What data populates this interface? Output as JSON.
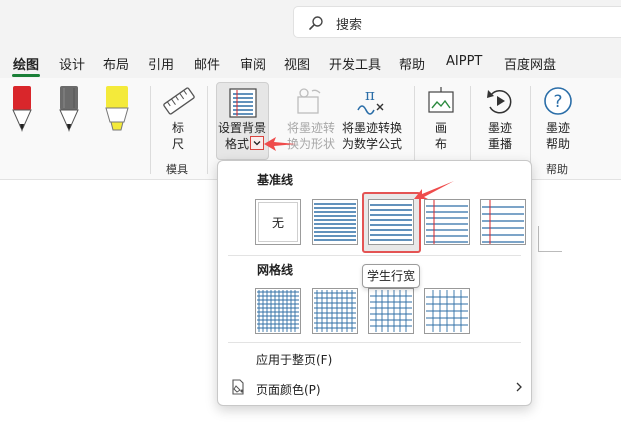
{
  "search": {
    "placeholder": "搜索"
  },
  "tabs": [
    {
      "label": "绘图",
      "active": true
    },
    {
      "label": "设计"
    },
    {
      "label": "布局"
    },
    {
      "label": "引用"
    },
    {
      "label": "邮件"
    },
    {
      "label": "审阅"
    },
    {
      "label": "视图"
    },
    {
      "label": "开发工具"
    },
    {
      "label": "帮助"
    },
    {
      "label": "AIPPT"
    },
    {
      "label": "百度网盘"
    }
  ],
  "ribbon": {
    "pens": [
      {
        "color": "#d9262b"
      },
      {
        "color": "#6b6b6b"
      },
      {
        "color": "#f4ea3a"
      }
    ],
    "ruler_label_1": "标",
    "ruler_label_2": "尺",
    "group_stencils": "模具",
    "bg_format_line1": "设置背景",
    "bg_format_line2": "格式",
    "ink_to_shape_line1": "将墨迹转",
    "ink_to_shape_line2": "换为形状",
    "ink_to_math_line1": "将墨迹转换",
    "ink_to_math_line2": "为数学公式",
    "canvas_line1": "画",
    "canvas_line2": "布",
    "replay_line1": "墨迹",
    "replay_line2": "重播",
    "help_line1": "墨迹",
    "help_line2": "帮助",
    "group_help": "帮助"
  },
  "popup": {
    "rule_lines_title": "基准线",
    "none_label": "无",
    "grid_lines_title": "网格线",
    "apply_to_all": "应用于整页(F)",
    "page_color": "页面颜色(P)",
    "tooltip": "学生行宽"
  },
  "colors": {
    "accent_green": "#1a7f37",
    "highlight_red": "#e45454",
    "line_blue": "#2e6ea6"
  }
}
